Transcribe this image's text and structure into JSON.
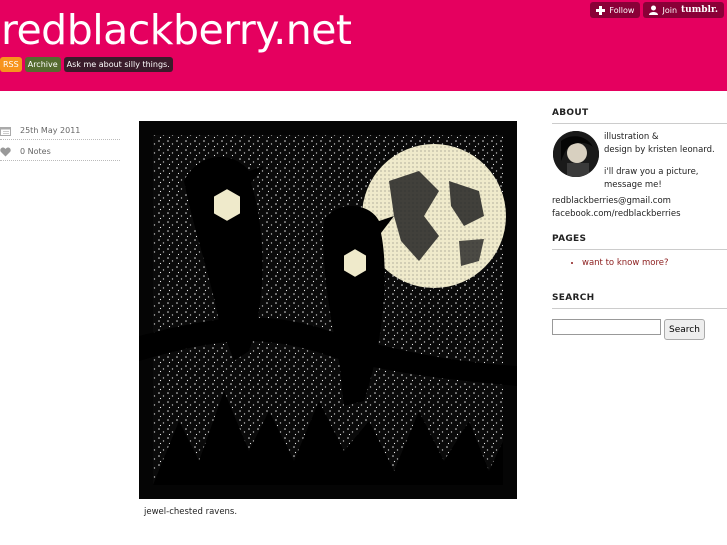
{
  "header": {
    "title": "redblackberry.net",
    "nav": {
      "rss": "RSS",
      "archive": "Archive",
      "ask": "Ask me about silly things."
    },
    "tumblr": {
      "follow": "Follow",
      "join": "Join",
      "brand": "tumblr."
    }
  },
  "post": {
    "date": "25th May 2011",
    "notes": "0 Notes",
    "caption": "jewel-chested ravens."
  },
  "sidebar": {
    "about_heading": "ABOUT",
    "about_line1": "illustration &",
    "about_line2": "design by kristen leonard.",
    "about_line3": "i'll draw you a picture,",
    "about_line4": "message me!",
    "about_email": "redblackberries@gmail.com",
    "about_facebook": "facebook.com/redblackberries",
    "pages_heading": "PAGES",
    "pages_item": "want to know more?",
    "search_heading": "SEARCH",
    "search_button": "Search",
    "search_value": ""
  },
  "colors": {
    "header_bg": "#e5005f",
    "rss": "#f7941d",
    "archive": "#556b2f",
    "ask": "#3a1b2a",
    "link": "#8b1c1c"
  },
  "icons": [
    "calendar-icon",
    "heart-icon",
    "plus-icon",
    "user-icon"
  ]
}
